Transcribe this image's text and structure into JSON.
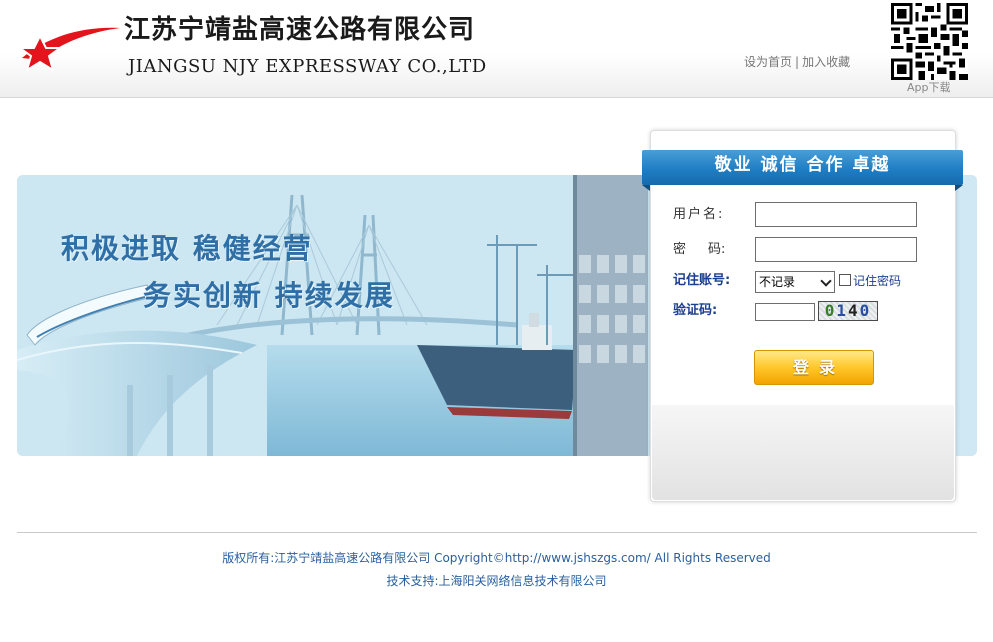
{
  "header": {
    "company_name_cn": "江苏宁靖盐高速公路有限公司",
    "company_name_en": "JIANGSU NJY EXPRESSWAY CO.,LTD",
    "links": {
      "set_home": "设为首页",
      "separator": "|",
      "add_favorite": "加入收藏"
    },
    "app_download": "App下载",
    "logo_icon": "red-star-logo-icon",
    "qr_icon": "qr-code-icon"
  },
  "banner": {
    "slogan_line1": "积极进取 稳健经营",
    "slogan_line2": "务实创新 持续发展"
  },
  "login": {
    "ribbon_title": "敬业 诚信 合作 卓越",
    "username_label": "用户名:",
    "password_label_a": "密",
    "password_label_b": "码:",
    "username_value": "",
    "password_value": "",
    "remember_account_label": "记住账号:",
    "remember_select_value": "不记录",
    "remember_password_label": "记住密码",
    "captcha_label": "验证码:",
    "captcha_value": "",
    "captcha_chars": [
      "0",
      "1",
      "4",
      "0"
    ],
    "login_button": "登录"
  },
  "footer": {
    "copyright": "版权所有:江苏宁靖盐高速公路有限公司 Copyright©http://www.jshszgs.com/ All Rights Reserved",
    "tech_support": "技术支持:上海阳关网络信息技术有限公司"
  },
  "colors": {
    "accent_blue": "#1f7ec4",
    "slogan_blue": "#2f6fa6",
    "footer_link": "#2a5f9e",
    "button_gold": "#ffc72a",
    "logo_red": "#e3141b"
  }
}
